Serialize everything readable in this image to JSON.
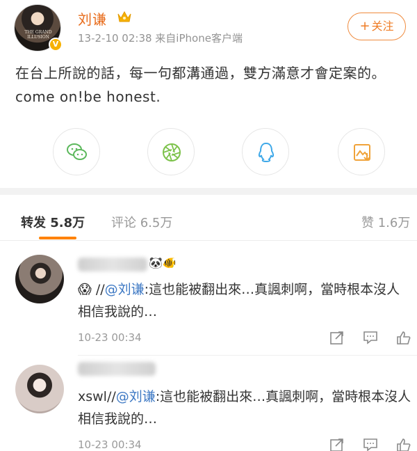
{
  "post": {
    "username": "刘谦",
    "meta": "13-2-10 02:38  来自iPhone客户端",
    "follow_label": "关注",
    "text": "在台上所說的話，每一句都溝通過，雙方滿意才會定案的。come on!be honest.",
    "avatar_text": "THE GRAND ILLUSION",
    "badge": "V"
  },
  "share": [
    "wechat-icon",
    "moments-icon",
    "qq-icon",
    "save-image-icon"
  ],
  "tabs": {
    "repost": "转发",
    "repost_count": "5.8万",
    "comment": "评论",
    "comment_count": "6.5万",
    "like": "赞",
    "like_count": "1.6万"
  },
  "comments": [
    {
      "prefix": "😱 //",
      "mention": "@刘谦",
      "text": ":這也能被翻出來…真諷刺啊，當時根本沒人相信我說的…",
      "time": "10-23 00:34",
      "name_emojis": "🐼🐠"
    },
    {
      "prefix": "xswl//",
      "mention": "@刘谦",
      "text": ":這也能被翻出來…真諷刺啊，當時根本沒人相信我說的…",
      "time": "10-23 00:34",
      "name_emojis": ""
    }
  ],
  "colors": {
    "accent": "#ff8200",
    "username": "#e86b1a",
    "mention": "#3e79c4"
  }
}
